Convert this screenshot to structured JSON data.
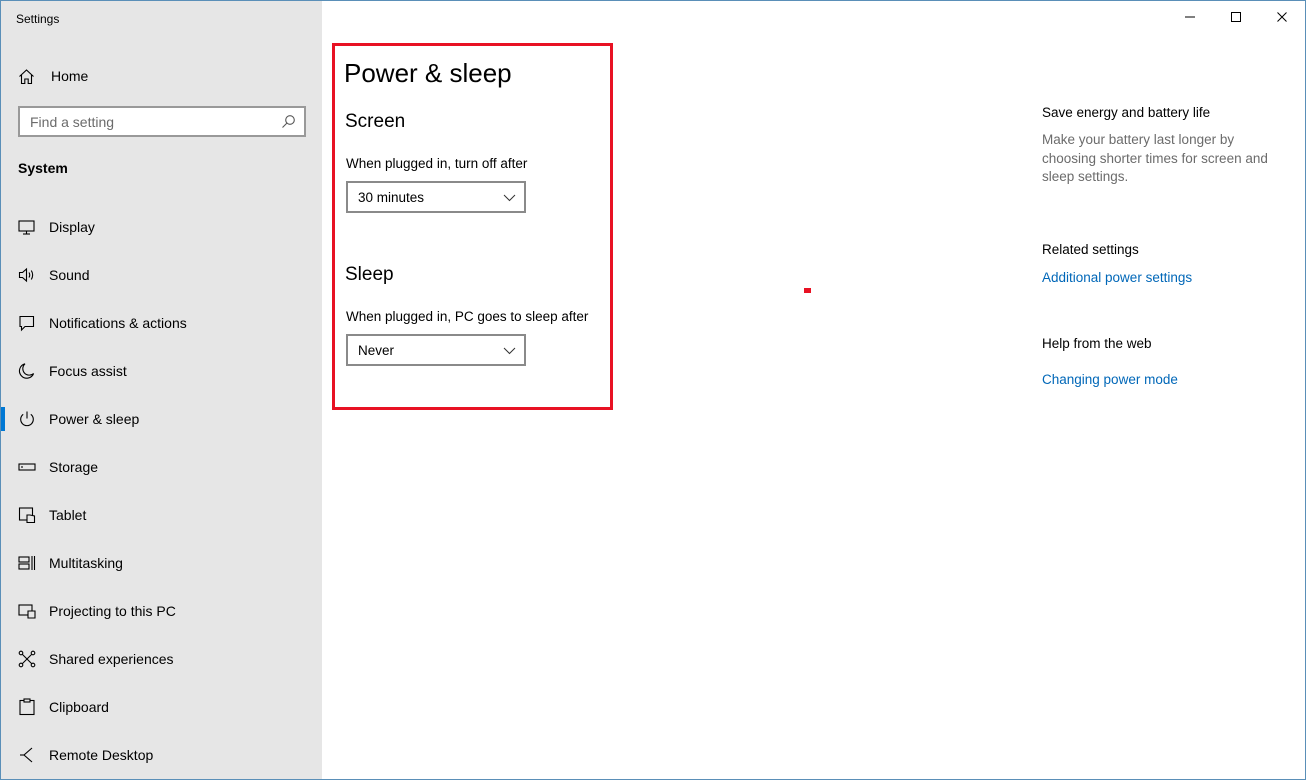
{
  "window": {
    "title": "Settings"
  },
  "sidebar": {
    "home_label": "Home",
    "search_placeholder": "Find a setting",
    "section_label": "System",
    "items": [
      {
        "label": "Display",
        "icon": "monitor-icon"
      },
      {
        "label": "Sound",
        "icon": "speaker-icon"
      },
      {
        "label": "Notifications & actions",
        "icon": "notification-icon"
      },
      {
        "label": "Focus assist",
        "icon": "moon-icon"
      },
      {
        "label": "Power & sleep",
        "icon": "power-icon",
        "active": true
      },
      {
        "label": "Storage",
        "icon": "storage-icon"
      },
      {
        "label": "Tablet",
        "icon": "tablet-icon"
      },
      {
        "label": "Multitasking",
        "icon": "multitasking-icon"
      },
      {
        "label": "Projecting to this PC",
        "icon": "projecting-icon"
      },
      {
        "label": "Shared experiences",
        "icon": "shared-icon"
      },
      {
        "label": "Clipboard",
        "icon": "clipboard-icon"
      },
      {
        "label": "Remote Desktop",
        "icon": "remote-desktop-icon"
      }
    ]
  },
  "main": {
    "title": "Power & sleep",
    "screen": {
      "heading": "Screen",
      "label": "When plugged in, turn off after",
      "value": "30 minutes"
    },
    "sleep": {
      "heading": "Sleep",
      "label": "When plugged in, PC goes to sleep after",
      "value": "Never"
    }
  },
  "right": {
    "energy_heading": "Save energy and battery life",
    "energy_text": "Make your battery last longer by choosing shorter times for screen and sleep settings.",
    "related_heading": "Related settings",
    "related_link": "Additional power settings",
    "help_heading": "Help from the web",
    "help_link": "Changing power mode"
  },
  "colors": {
    "accent": "#0078d4",
    "highlight": "#e81123",
    "link": "#0067b8",
    "sidebar_bg": "#e6e6e6"
  }
}
